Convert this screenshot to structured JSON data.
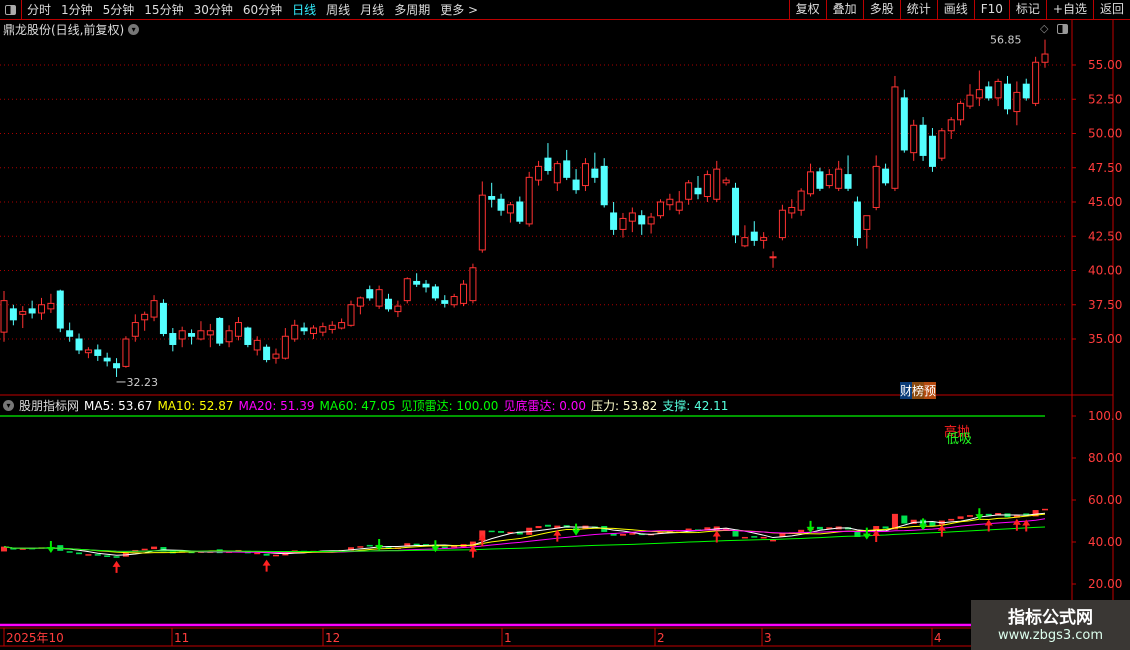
{
  "toolbar": {
    "periods": [
      "分时",
      "1分钟",
      "5分钟",
      "15分钟",
      "30分钟",
      "60分钟",
      "日线",
      "周线",
      "月线",
      "多周期",
      "更多 >"
    ],
    "active": "日线",
    "right_buttons": [
      "复权",
      "叠加",
      "多股",
      "统计",
      "画线",
      "F10",
      "标记",
      "+自选",
      "返回"
    ]
  },
  "title": "鼎龙股份(日线,前复权)",
  "price_axis": {
    "ticks": [
      "55.00",
      "52.50",
      "50.00",
      "47.50",
      "45.00",
      "42.50",
      "40.00",
      "37.50",
      "35.00"
    ],
    "values": [
      55,
      52.5,
      50,
      47.5,
      45,
      42.5,
      40,
      37.5,
      35
    ]
  },
  "annotations": {
    "high": "56.85",
    "low": "32.23",
    "badges": [
      "财",
      "榜",
      "预"
    ]
  },
  "indicator": {
    "name": "股朋指标网",
    "ma5": "MA5: 53.67",
    "ma10": "MA10: 52.87",
    "ma20": "MA20: 51.39",
    "ma60": "MA60: 47.05",
    "top": "见顶雷达: 100.00",
    "bottom": "见底雷达: 0.00",
    "pressure": "压力: 53.82",
    "support": "支撑: 42.11",
    "signal_high": "高抛",
    "signal_low": "低吸",
    "axis": [
      "100.0",
      "80.00",
      "60.00",
      "40.00",
      "20.00"
    ]
  },
  "time_axis": [
    "2025年10",
    "11",
    "12",
    "1",
    "2",
    "3",
    "4"
  ],
  "watermark": {
    "line1": "指标公式网",
    "line2": "www.zbgs3.com"
  },
  "colors": {
    "up": "#ff3232",
    "down": "#54ffff",
    "axis": "#c00000",
    "ma5": "#ffffff",
    "ma10": "#ffff00",
    "ma20": "#ff00ff",
    "ma60": "#00ff00"
  },
  "chart_data": {
    "type": "candlestick",
    "columns": [
      "open",
      "high",
      "low",
      "close"
    ],
    "ylim": [
      33,
      57
    ],
    "candles": [
      [
        35.5,
        38.5,
        34.8,
        37.8
      ],
      [
        37.2,
        37.5,
        36.0,
        36.4
      ],
      [
        36.8,
        37.4,
        35.8,
        37.0
      ],
      [
        37.2,
        37.8,
        36.5,
        36.9
      ],
      [
        36.9,
        38.0,
        36.4,
        37.5
      ],
      [
        37.2,
        38.3,
        36.9,
        37.6
      ],
      [
        38.5,
        38.6,
        35.5,
        35.8
      ],
      [
        35.6,
        36.2,
        34.8,
        35.2
      ],
      [
        35.0,
        35.4,
        33.9,
        34.2
      ],
      [
        34.0,
        34.4,
        33.6,
        34.2
      ],
      [
        34.2,
        34.6,
        33.4,
        33.8
      ],
      [
        33.6,
        34.0,
        33.0,
        33.4
      ],
      [
        33.2,
        33.6,
        32.23,
        32.9
      ],
      [
        33.0,
        35.2,
        32.9,
        35.0
      ],
      [
        35.2,
        36.8,
        34.8,
        36.2
      ],
      [
        36.4,
        37.0,
        35.6,
        36.8
      ],
      [
        36.6,
        38.2,
        36.3,
        37.8
      ],
      [
        37.6,
        37.9,
        35.2,
        35.4
      ],
      [
        35.4,
        35.8,
        34.1,
        34.6
      ],
      [
        35.0,
        35.9,
        34.4,
        35.6
      ],
      [
        35.4,
        35.7,
        34.6,
        35.2
      ],
      [
        35.0,
        36.3,
        34.9,
        35.6
      ],
      [
        35.3,
        36.1,
        34.4,
        35.6
      ],
      [
        36.5,
        36.6,
        34.5,
        34.7
      ],
      [
        34.8,
        36.0,
        34.4,
        35.6
      ],
      [
        35.2,
        36.6,
        34.9,
        36.2
      ],
      [
        35.8,
        35.9,
        34.4,
        34.6
      ],
      [
        34.2,
        35.2,
        33.8,
        34.9
      ],
      [
        34.4,
        34.6,
        33.3,
        33.5
      ],
      [
        33.6,
        34.3,
        33.2,
        33.9
      ],
      [
        33.6,
        35.8,
        33.5,
        35.2
      ],
      [
        35.0,
        36.4,
        34.8,
        36.0
      ],
      [
        35.8,
        36.2,
        35.3,
        35.6
      ],
      [
        35.4,
        36.0,
        35.0,
        35.8
      ],
      [
        35.5,
        36.2,
        35.2,
        35.9
      ],
      [
        35.7,
        36.3,
        35.4,
        36.0
      ],
      [
        35.8,
        36.5,
        35.7,
        36.2
      ],
      [
        36.0,
        37.8,
        35.9,
        37.5
      ],
      [
        37.4,
        38.1,
        36.8,
        38.0
      ],
      [
        38.6,
        38.9,
        37.8,
        38.0
      ],
      [
        37.4,
        38.9,
        37.2,
        38.6
      ],
      [
        37.9,
        38.3,
        37.0,
        37.2
      ],
      [
        37.0,
        37.8,
        36.6,
        37.4
      ],
      [
        37.8,
        39.5,
        37.6,
        39.4
      ],
      [
        39.2,
        39.8,
        38.8,
        39.0
      ],
      [
        39.0,
        39.3,
        38.4,
        38.8
      ],
      [
        38.8,
        39.0,
        37.8,
        38.0
      ],
      [
        37.8,
        38.2,
        37.3,
        37.6
      ],
      [
        37.5,
        38.3,
        37.3,
        38.1
      ],
      [
        37.6,
        39.3,
        37.4,
        39.0
      ],
      [
        37.8,
        40.5,
        37.6,
        40.2
      ],
      [
        41.5,
        46.5,
        41.3,
        45.5
      ],
      [
        45.4,
        46.4,
        44.6,
        45.2
      ],
      [
        45.2,
        45.6,
        44.0,
        44.4
      ],
      [
        44.2,
        45.0,
        43.5,
        44.8
      ],
      [
        45.0,
        45.4,
        43.4,
        43.6
      ],
      [
        43.4,
        47.2,
        43.2,
        46.8
      ],
      [
        46.6,
        48.0,
        46.2,
        47.6
      ],
      [
        48.2,
        49.3,
        47.0,
        47.3
      ],
      [
        46.4,
        48.0,
        45.8,
        47.8
      ],
      [
        48.0,
        48.8,
        46.6,
        46.8
      ],
      [
        46.6,
        47.4,
        45.6,
        45.9
      ],
      [
        46.2,
        48.2,
        45.8,
        47.8
      ],
      [
        47.4,
        48.6,
        46.4,
        46.8
      ],
      [
        47.6,
        48.2,
        44.6,
        44.8
      ],
      [
        44.2,
        45.0,
        42.6,
        43.0
      ],
      [
        43.0,
        44.2,
        42.4,
        43.8
      ],
      [
        43.6,
        44.6,
        42.8,
        44.2
      ],
      [
        44.0,
        44.4,
        42.6,
        43.4
      ],
      [
        43.4,
        44.2,
        42.7,
        43.9
      ],
      [
        44.0,
        45.2,
        43.8,
        45.0
      ],
      [
        44.8,
        45.6,
        44.4,
        45.2
      ],
      [
        44.4,
        45.8,
        44.1,
        45.0
      ],
      [
        45.2,
        46.6,
        44.8,
        46.4
      ],
      [
        46.0,
        46.9,
        45.2,
        45.6
      ],
      [
        45.4,
        47.3,
        45.0,
        47.0
      ],
      [
        45.2,
        48.0,
        45.0,
        47.4
      ],
      [
        46.4,
        46.8,
        46.2,
        46.6
      ],
      [
        46.0,
        46.4,
        42.0,
        42.6
      ],
      [
        41.8,
        43.3,
        41.7,
        42.4
      ],
      [
        42.8,
        43.6,
        41.8,
        42.2
      ],
      [
        42.2,
        42.8,
        41.6,
        42.4
      ],
      [
        41.0,
        41.4,
        40.2,
        41.0
      ],
      [
        42.4,
        44.8,
        42.2,
        44.4
      ],
      [
        44.2,
        45.2,
        43.8,
        44.6
      ],
      [
        44.4,
        46.0,
        44.0,
        45.8
      ],
      [
        45.6,
        47.8,
        45.4,
        47.2
      ],
      [
        47.2,
        47.5,
        45.8,
        46.0
      ],
      [
        46.2,
        47.4,
        46.0,
        47.0
      ],
      [
        46.0,
        48.0,
        45.8,
        47.4
      ],
      [
        47.0,
        48.4,
        45.8,
        46.0
      ],
      [
        45.0,
        45.4,
        41.8,
        42.4
      ],
      [
        43.0,
        44.0,
        41.6,
        44.0
      ],
      [
        44.6,
        48.4,
        44.4,
        47.6
      ],
      [
        47.4,
        47.8,
        46.2,
        46.4
      ],
      [
        46.0,
        54.2,
        45.8,
        53.4
      ],
      [
        52.6,
        53.2,
        48.6,
        48.8
      ],
      [
        48.6,
        51.0,
        48.0,
        50.6
      ],
      [
        50.6,
        51.2,
        48.0,
        48.4
      ],
      [
        49.8,
        50.4,
        47.2,
        47.6
      ],
      [
        48.2,
        50.4,
        48.0,
        50.2
      ],
      [
        50.2,
        51.2,
        49.6,
        51.0
      ],
      [
        51.0,
        52.4,
        50.6,
        52.2
      ],
      [
        52.0,
        53.6,
        51.8,
        52.8
      ],
      [
        52.6,
        54.6,
        52.0,
        53.2
      ],
      [
        53.4,
        53.8,
        52.4,
        52.6
      ],
      [
        52.6,
        54.0,
        52.0,
        53.8
      ],
      [
        53.6,
        54.2,
        51.4,
        51.8
      ],
      [
        51.6,
        53.8,
        50.6,
        53.0
      ],
      [
        53.6,
        54.0,
        52.4,
        52.6
      ],
      [
        52.2,
        55.6,
        52.0,
        55.2
      ],
      [
        55.2,
        56.85,
        54.8,
        55.8
      ]
    ]
  }
}
